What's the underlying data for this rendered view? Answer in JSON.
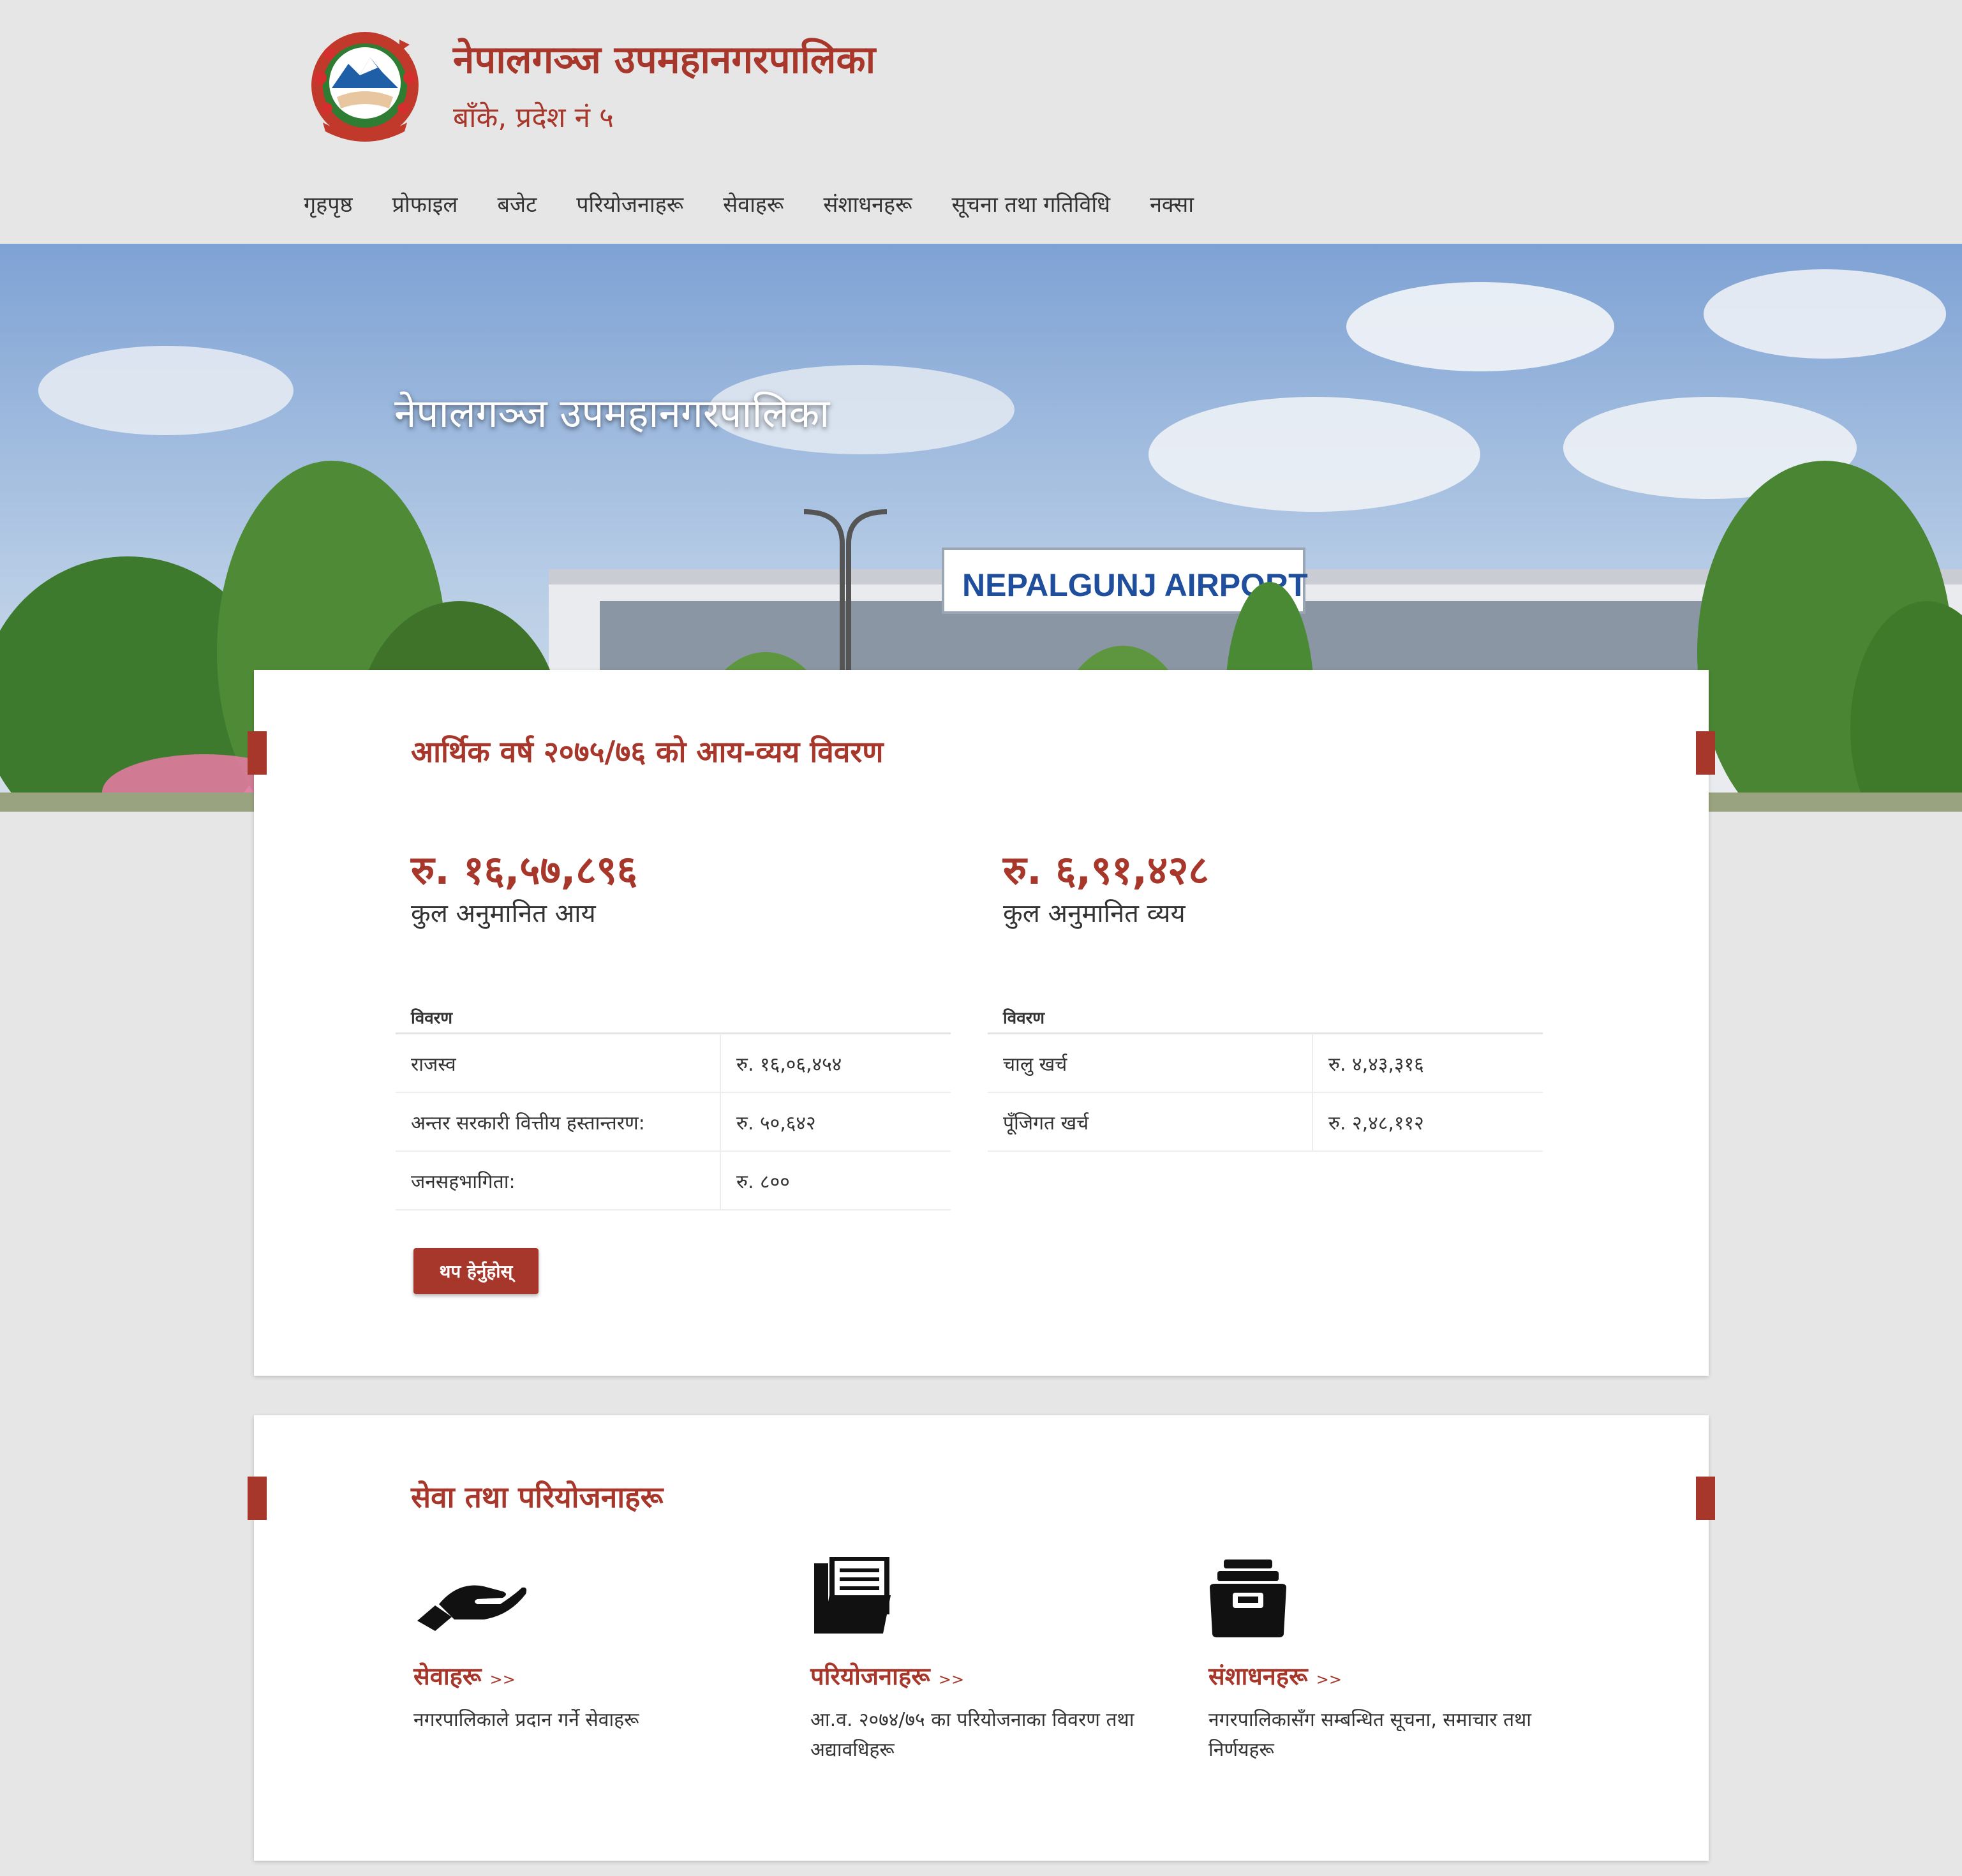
{
  "header": {
    "title": "नेपालगञ्ज उपमहानगरपालिका",
    "subtitle": "बाँके, प्रदेश नं ५",
    "logo_icon": "nepal-emblem-icon"
  },
  "nav": [
    "गृहपृष्ठ",
    "प्रोफाइल",
    "बजेट",
    "परियोजनाहरू",
    "सेवाहरू",
    "संशाधनहरू",
    "सूचना तथा गतिविधि",
    "नक्सा"
  ],
  "hero": {
    "title": "नेपालगञ्ज उपमहानगरपालिका",
    "sign_text": "NEPALGUNJ AIRPORT"
  },
  "budget": {
    "title": "आर्थिक वर्ष २०७५/७६ को आय-व्यय विवरण",
    "income": {
      "amount": "रु. १६,५७,८९६",
      "label": "कुल अनुमानित आय",
      "header": "विवरण",
      "rows": [
        {
          "name": "राजस्व",
          "value": "रु. १६,०६,४५४"
        },
        {
          "name": "अन्तर सरकारी वित्तीय हस्तान्तरण:",
          "value": "रु. ५०,६४२"
        },
        {
          "name": "जनसहभागिता:",
          "value": "रु. ८००"
        }
      ]
    },
    "expense": {
      "amount": "रु. ६,९१,४२८",
      "label": "कुल अनुमानित व्यय",
      "header": "विवरण",
      "rows": [
        {
          "name": "चालु खर्च",
          "value": "रु. ४,४३,३१६"
        },
        {
          "name": "पूँजिगत खर्च",
          "value": "रु. २,४८,११२"
        }
      ]
    },
    "more_button": "थप हेर्नुहोस्"
  },
  "services": {
    "title": "सेवा तथा परियोजनाहरू",
    "arrow": ">>",
    "items": [
      {
        "icon": "hand-icon",
        "label": "सेवाहरू",
        "desc": "नगरपालिकाले प्रदान गर्ने सेवाहरू"
      },
      {
        "icon": "folder-documents-icon",
        "label": "परियोजनाहरू",
        "desc": "आ.व. २०७४/७५ का परियोजनाका विवरण तथा अद्यावधिहरू"
      },
      {
        "icon": "archive-box-icon",
        "label": "संशाधनहरू",
        "desc": "नगरपालिकासँग सम्बन्धित सूचना, समाचार तथा निर्णयहरू"
      }
    ]
  },
  "colors": {
    "accent": "#a8372b",
    "background": "#e6e6e6",
    "card": "#ffffff"
  }
}
